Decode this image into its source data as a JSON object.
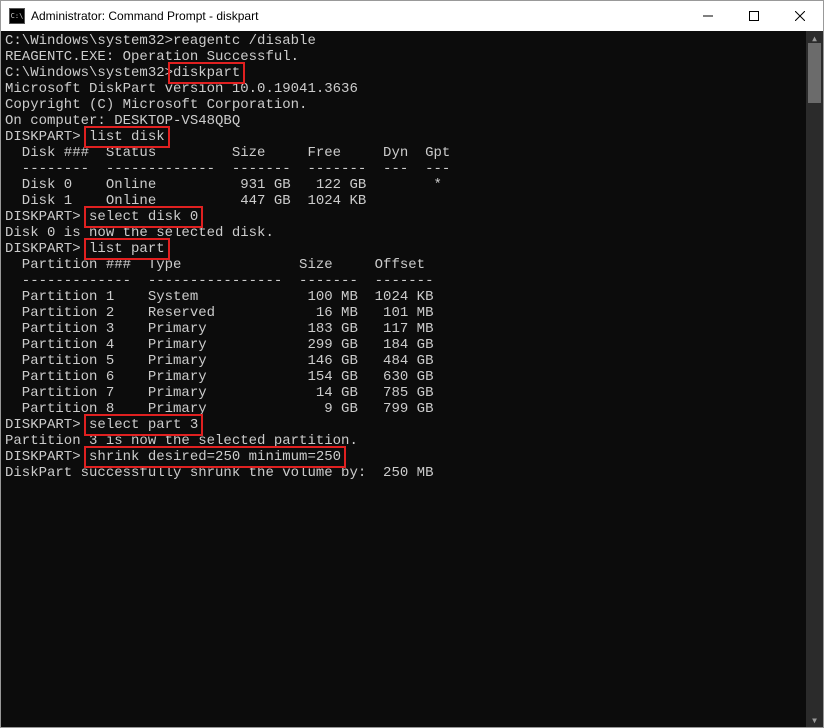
{
  "title": "Administrator: Command Prompt - diskpart",
  "highlight_color": "#e02020",
  "lines": {
    "l1a": "C:\\Windows\\system32>reagentc /disable",
    "l1b": "REAGENTC.EXE: Operation Successful.",
    "l2": "",
    "l3a": "C:\\Windows\\system32>",
    "l3b": "diskpart",
    "l4": "",
    "l5": "Microsoft DiskPart version 10.0.19041.3636",
    "l6": "",
    "l7": "Copyright (C) Microsoft Corporation.",
    "l8": "On computer: DESKTOP-VS48QBQ",
    "l9": "",
    "l10a": "DISKPART> ",
    "l10b": "list disk",
    "l11": "",
    "l12": "  Disk ###  Status         Size     Free     Dyn  Gpt",
    "l13": "  --------  -------------  -------  -------  ---  ---",
    "l14": "  Disk 0    Online          931 GB   122 GB        *",
    "l15": "  Disk 1    Online          447 GB  1024 KB",
    "l16": "",
    "l17a": "DISKPART> ",
    "l17b": "select disk 0",
    "l18": "",
    "l19": "Disk 0 is now the selected disk.",
    "l20": "",
    "l21a": "DISKPART> ",
    "l21b": "list part",
    "l22": "",
    "l23": "  Partition ###  Type              Size     Offset",
    "l24": "  -------------  ----------------  -------  -------",
    "l25": "  Partition 1    System             100 MB  1024 KB",
    "l26": "  Partition 2    Reserved            16 MB   101 MB",
    "l27": "  Partition 3    Primary            183 GB   117 MB",
    "l28": "  Partition 4    Primary            299 GB   184 GB",
    "l29": "  Partition 5    Primary            146 GB   484 GB",
    "l30": "  Partition 6    Primary            154 GB   630 GB",
    "l31": "  Partition 7    Primary             14 GB   785 GB",
    "l32": "  Partition 8    Primary              9 GB   799 GB",
    "l33": "",
    "l34a": "DISKPART> ",
    "l34b": "select part 3",
    "l35": "",
    "l36": "Partition 3 is now the selected partition.",
    "l37": "",
    "l38a": "DISKPART> ",
    "l38b": "shrink desired=250 minimum=250",
    "l39": "",
    "l40": "DiskPart successfully shrunk the volume by:  250 MB"
  },
  "disks": [
    {
      "id": "Disk 0",
      "status": "Online",
      "size": "931 GB",
      "free": "122 GB",
      "dyn": "",
      "gpt": "*"
    },
    {
      "id": "Disk 1",
      "status": "Online",
      "size": "447 GB",
      "free": "1024 KB",
      "dyn": "",
      "gpt": ""
    }
  ],
  "partitions": [
    {
      "id": "Partition 1",
      "type": "System",
      "size": "100 MB",
      "offset": "1024 KB"
    },
    {
      "id": "Partition 2",
      "type": "Reserved",
      "size": "16 MB",
      "offset": "101 MB"
    },
    {
      "id": "Partition 3",
      "type": "Primary",
      "size": "183 GB",
      "offset": "117 MB"
    },
    {
      "id": "Partition 4",
      "type": "Primary",
      "size": "299 GB",
      "offset": "184 GB"
    },
    {
      "id": "Partition 5",
      "type": "Primary",
      "size": "146 GB",
      "offset": "484 GB"
    },
    {
      "id": "Partition 6",
      "type": "Primary",
      "size": "154 GB",
      "offset": "630 GB"
    },
    {
      "id": "Partition 7",
      "type": "Primary",
      "size": "14 GB",
      "offset": "785 GB"
    },
    {
      "id": "Partition 8",
      "type": "Primary",
      "size": "9 GB",
      "offset": "799 GB"
    }
  ],
  "commands": {
    "diskpart": "diskpart",
    "list_disk": "list disk",
    "select_disk_0": "select disk 0",
    "list_part": "list part",
    "select_part_3": "select part 3",
    "shrink": "shrink desired=250 minimum=250"
  }
}
